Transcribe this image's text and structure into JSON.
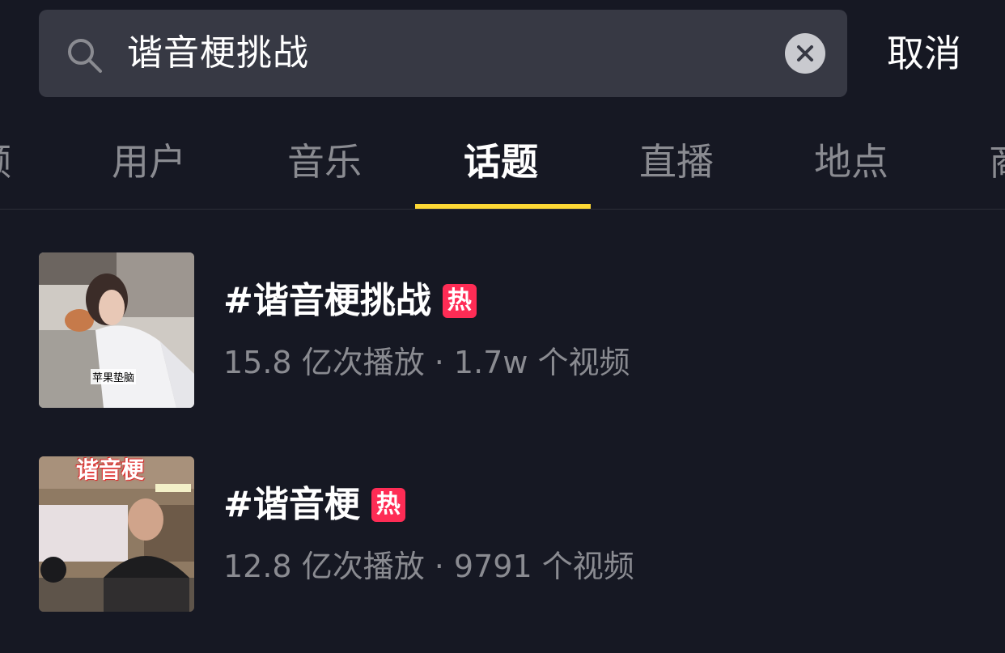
{
  "search": {
    "query": "谐音梗挑战",
    "cancel_label": "取消"
  },
  "tabs": [
    {
      "label": "视频"
    },
    {
      "label": "用户"
    },
    {
      "label": "音乐"
    },
    {
      "label": "话题",
      "active": true
    },
    {
      "label": "直播"
    },
    {
      "label": "地点"
    },
    {
      "label": "商品"
    }
  ],
  "results": [
    {
      "title": "#谐音梗挑战",
      "badge": "热",
      "stats": "15.8 亿次播放 · 1.7w 个视频",
      "thumb_caption": "苹果垫脑"
    },
    {
      "title": "#谐音梗",
      "badge": "热",
      "stats": "12.8 亿次播放 · 9791 个视频",
      "thumb_title": "谐音梗"
    }
  ],
  "colors": {
    "background": "#161823",
    "search_bg": "#373944",
    "tab_indicator": "#fdd835",
    "hot_badge": "#fe2c55",
    "secondary_text": "#8a8b91"
  }
}
